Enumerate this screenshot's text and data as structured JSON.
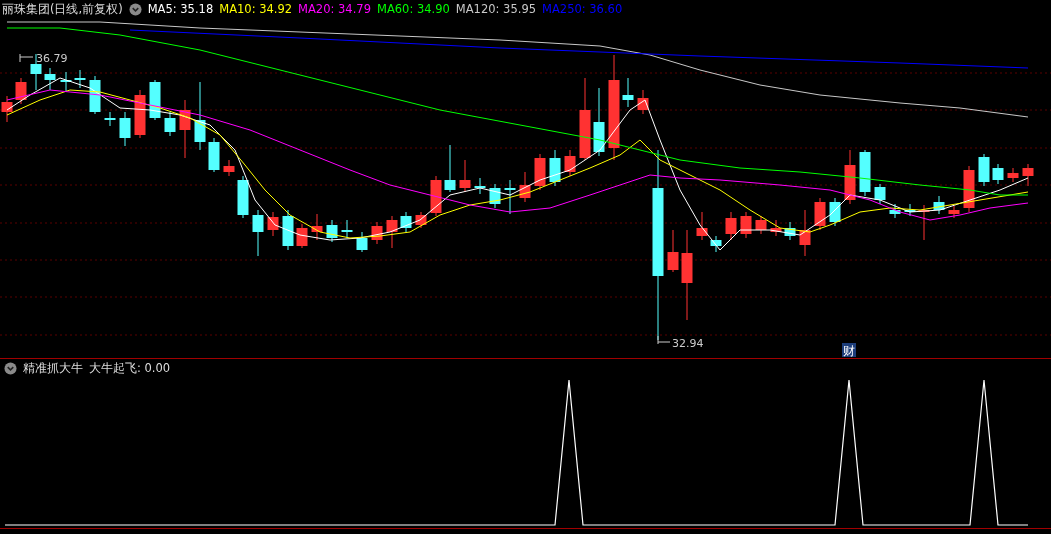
{
  "title": "丽珠集团(日线,前复权)",
  "legend": [
    {
      "label": "MA5: 35.18",
      "color": "#ffffff"
    },
    {
      "label": "MA10: 34.92",
      "color": "#ffff00"
    },
    {
      "label": "MA20: 34.79",
      "color": "#ff00ff"
    },
    {
      "label": "MA60: 34.90",
      "color": "#00ff00"
    },
    {
      "label": "MA120: 35.95",
      "color": "#c8c8c8"
    },
    {
      "label": "MA250: 36.60",
      "color": "#0000ff"
    }
  ],
  "price_labels": {
    "high": "36.79",
    "low": "32.94"
  },
  "event_marker": "财",
  "indicator": {
    "title": "精准抓大牛",
    "legend": "大牛起飞: 0.00"
  }
}
